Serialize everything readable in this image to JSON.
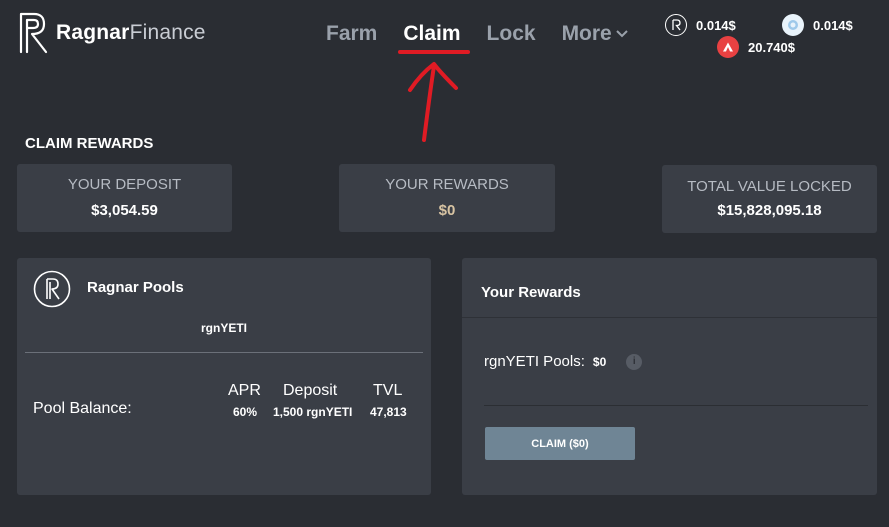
{
  "brand": {
    "name_bold": "Ragnar",
    "name_light": "Finance"
  },
  "nav": {
    "farm": "Farm",
    "claim": "Claim",
    "lock": "Lock",
    "more": "More"
  },
  "prices": {
    "rgn": "0.014$",
    "yeti": "0.014$",
    "avax": "20.740$"
  },
  "page": {
    "title": "CLAIM REWARDS"
  },
  "stats": {
    "deposit": {
      "label": "YOUR DEPOSIT",
      "value": "$3,054.59"
    },
    "rewards": {
      "label": "YOUR REWARDS",
      "value": "$0"
    },
    "tvl": {
      "label": "TOTAL VALUE LOCKED",
      "value": "$15,828,095.18"
    }
  },
  "pools": {
    "title": "Ragnar Pools",
    "subtitle": "rgnYETI",
    "balance_label": "Pool Balance:",
    "columns": [
      {
        "header": "APR",
        "value": "60%"
      },
      {
        "header": "Deposit",
        "value": "1,500 rgnYETI"
      },
      {
        "header": "TVL",
        "value": "47,813"
      }
    ]
  },
  "your_rewards": {
    "title": "Your Rewards",
    "pool_label": "rgnYETI Pools:",
    "pool_value": "$0",
    "info_glyph": "i",
    "claim_button": "CLAIM ($0)"
  },
  "colors": {
    "background": "#2a2d33",
    "card": "#3a3e46",
    "annotation": "#e01b24",
    "claim_button": "#6f8595",
    "reward_value": "#d8c4a3"
  }
}
